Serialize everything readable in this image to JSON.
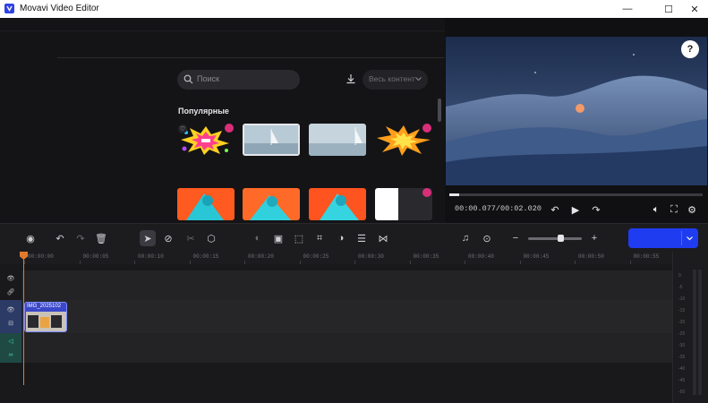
{
  "window": {
    "title": "Movavi Video Editor",
    "minimize": "—",
    "maximize": "☐",
    "close": "✕"
  },
  "browser": {
    "search_placeholder": "Поиск",
    "content_filter": "Весь контент",
    "section_title": "Популярные"
  },
  "preview": {
    "timecode": "00:00.077/00:02.020",
    "progress": 0.04,
    "help": "?"
  },
  "toolbar": {
    "export_label": ""
  },
  "ruler": {
    "ticks": [
      "00:00:00",
      "00:00:05",
      "00:00:10",
      "00:00:15",
      "00:00:20",
      "00:00:25",
      "00:00:30",
      "00:00:35",
      "00:00:40",
      "00:00:45",
      "00:00:50",
      "00:00:55"
    ]
  },
  "timeline": {
    "clip_name": "IMG_2025102"
  },
  "meter": {
    "labels": [
      "0",
      "-5",
      "-10",
      "-15",
      "-20",
      "-25",
      "-30",
      "-35",
      "-40",
      "-45",
      "-50"
    ]
  },
  "zoom_level": 0.6,
  "colors": {
    "accent": "#1f3cf0",
    "playhead": "#e27a2c",
    "favorite_badge": "#d92f7a"
  }
}
